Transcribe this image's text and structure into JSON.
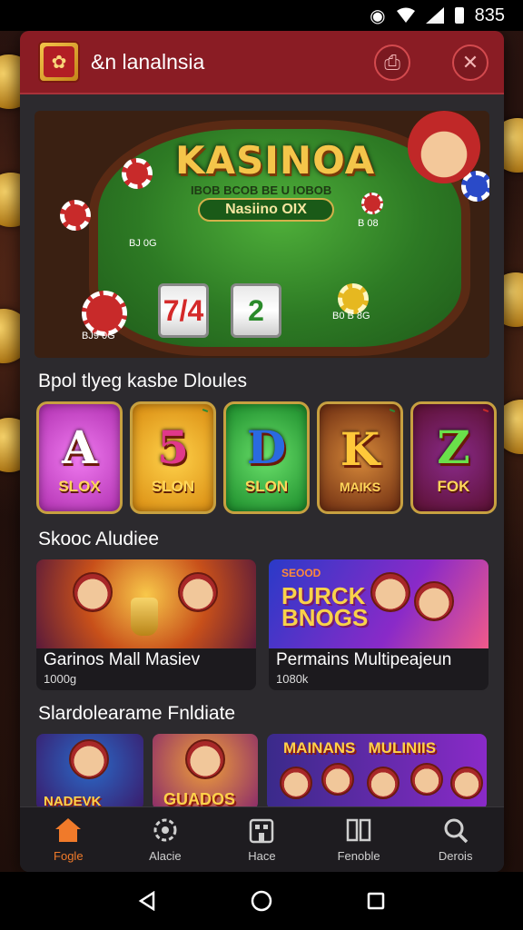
{
  "status_bar": {
    "time": "835"
  },
  "header": {
    "app_title": "&n lanalnsia"
  },
  "hero": {
    "title": "KASINOA",
    "subtitle": "IBOB BCOB BE U IOBOB",
    "badge": "Nasiino OIX",
    "label_left_top": "BJ 0G",
    "label_left_bottom": "BJ9 0G",
    "label_right_top": "B 08",
    "label_right_bottom": "B0 B 8G",
    "reels": [
      "7/4",
      "2"
    ]
  },
  "sections": {
    "slots_title": "Bpol tlyeg kasbe Dloules",
    "featured_title": "Skooc Aludiee",
    "more_title": "Slardolearame Fnldiate"
  },
  "slots": [
    {
      "letter": "A",
      "name": "SLOX",
      "bg": "#d84ad8"
    },
    {
      "letter": "5",
      "name": "SLON",
      "bg": "#f0a020"
    },
    {
      "letter": "D",
      "name": "SLON",
      "bg": "#2fb83a"
    },
    {
      "letter": "K",
      "name": "MAIKS",
      "bg": "#8a4a18"
    },
    {
      "letter": "Z",
      "name": "FOK",
      "bg": "#9a1a2a"
    }
  ],
  "featured": [
    {
      "name": "Garinos Mall Masiev",
      "count": "1000g"
    },
    {
      "name": "Permains Multipeajeun",
      "count": "1080k",
      "headline_small": "SEOOD",
      "headline": "PURCK BNOGS"
    }
  ],
  "more": [
    {
      "text": "NADEVK"
    },
    {
      "text": "GUADOS"
    },
    {
      "text": "MAINANS   MULINIIS"
    }
  ],
  "nav": [
    {
      "label": "Fogle",
      "icon": "home-icon",
      "active": true
    },
    {
      "label": "Alacie",
      "icon": "settings-icon",
      "active": false
    },
    {
      "label": "Hace",
      "icon": "building-icon",
      "active": false
    },
    {
      "label": "Fenoble",
      "icon": "book-icon",
      "active": false
    },
    {
      "label": "Derois",
      "icon": "search-icon",
      "active": false
    }
  ],
  "accent_color": "#f07a2a",
  "header_color": "#8a1c24"
}
